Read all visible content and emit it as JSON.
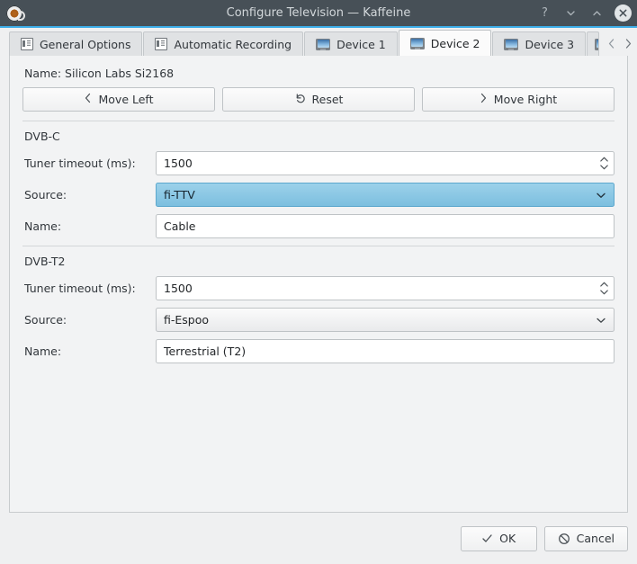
{
  "window": {
    "title": "Configure Television — Kaffeine",
    "app_icon": "kaffeine-cup-icon",
    "controls": {
      "help": "?",
      "minimize": "minimize-icon",
      "maximize": "maximize-icon",
      "close": "close-icon"
    }
  },
  "tabs": [
    {
      "label": "General Options",
      "icon": "document-list-icon",
      "active": false
    },
    {
      "label": "Automatic Recording",
      "icon": "document-list-icon",
      "active": false
    },
    {
      "label": "Device 1",
      "icon": "tv-device-icon",
      "active": false
    },
    {
      "label": "Device 2",
      "icon": "tv-device-icon",
      "active": true
    },
    {
      "label": "Device 3",
      "icon": "tv-device-icon",
      "active": false
    },
    {
      "label": "",
      "icon": "tv-device-icon",
      "active": false
    }
  ],
  "tab_scroll": {
    "left": "‹",
    "right": "›"
  },
  "device": {
    "name_line": "Name: Silicon Labs Si2168",
    "buttons": [
      {
        "label": "Move Left",
        "glyph": "‹",
        "icon": "chevron-left-icon"
      },
      {
        "label": "Reset",
        "glyph": "↺",
        "icon": "reset-icon"
      },
      {
        "label": "Move Right",
        "glyph": "›",
        "icon": "chevron-right-icon"
      }
    ]
  },
  "groups": [
    {
      "title": "DVB-C",
      "tuner_timeout_label": "Tuner timeout (ms):",
      "tuner_timeout_value": "1500",
      "source_label": "Source:",
      "source_value": "fi-TTV",
      "source_selected": true,
      "name_label": "Name:",
      "name_value": "Cable"
    },
    {
      "title": "DVB-T2",
      "tuner_timeout_label": "Tuner timeout (ms):",
      "tuner_timeout_value": "1500",
      "source_label": "Source:",
      "source_value": "fi-Espoo",
      "source_selected": false,
      "name_label": "Name:",
      "name_value": "Terrestrial (T2)"
    }
  ],
  "dialog_buttons": {
    "ok": {
      "label": "OK",
      "icon": "check-icon"
    },
    "cancel": {
      "label": "Cancel",
      "icon": "cancel-circle-slash-icon"
    }
  },
  "colors": {
    "titlebar": "#475057",
    "accent": "#3daee9",
    "panel": "#f2f3f4",
    "selection": "#7cbfdf",
    "window_bg": "#eff0f1"
  }
}
